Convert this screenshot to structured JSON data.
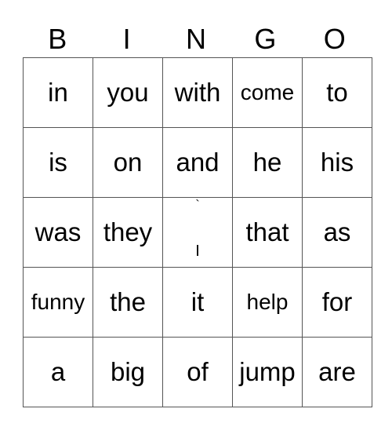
{
  "header": [
    "B",
    "I",
    "N",
    "G",
    "O"
  ],
  "rows": [
    [
      "in",
      "you",
      "with",
      "come",
      "to"
    ],
    [
      "is",
      "on",
      "and",
      "he",
      "his"
    ],
    [
      "was",
      "they",
      "",
      "that",
      "as"
    ],
    [
      "funny",
      "the",
      "it",
      "help",
      "for"
    ],
    [
      "a",
      "big",
      "of",
      "jump",
      "are"
    ]
  ],
  "free_cell": {
    "top_mark": "`",
    "bottom_mark": "I"
  }
}
